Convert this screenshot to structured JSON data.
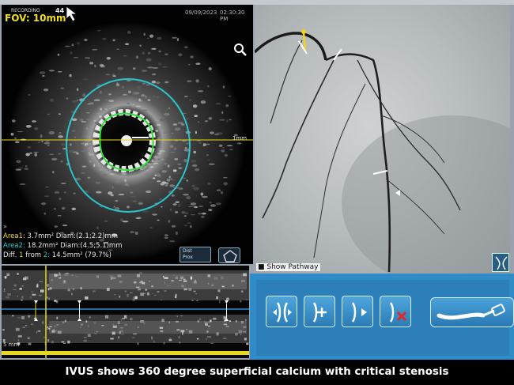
{
  "ivus": {
    "fov_label": "FOV: 10mm",
    "recording_label": "RECORDING",
    "frame_number": "44",
    "date": "09/09/2023",
    "time": "02:30:30 PM",
    "scale_label": "1mm",
    "measurements": {
      "area1": {
        "label": "Area1:",
        "value": "3.7mm² Diam:(2.1;2.2)mm"
      },
      "area2": {
        "label": "Area2:",
        "value": "18.2mm² Diam:(4.5;5.1)mm"
      },
      "diff": {
        "label": "Diff.",
        "from_1": "1",
        "from_word": "from",
        "from_2": "2:",
        "value": "14.5mm²  (79.7%)"
      }
    },
    "dist_button": {
      "top": "Dist",
      "bottom": "Prox"
    },
    "colors": {
      "lumen_border": "#2ee03a",
      "vessel_border": "#29c5cc",
      "measure_axis": "#e8d81a"
    }
  },
  "angio": {
    "show_pathway_label": "Show Pathway"
  },
  "longitudinal": {
    "scale_label": "5 mm"
  },
  "tools": {
    "buttons": [
      {
        "name": "distal-marker"
      },
      {
        "name": "add-marker"
      },
      {
        "name": "proximal-marker"
      },
      {
        "name": "delete-marker"
      },
      {
        "name": "catheter-pullback"
      }
    ],
    "accent": "#2f8cc9"
  },
  "caption": "IVUS shows 360 degree superficial calcium with critical stenosis"
}
